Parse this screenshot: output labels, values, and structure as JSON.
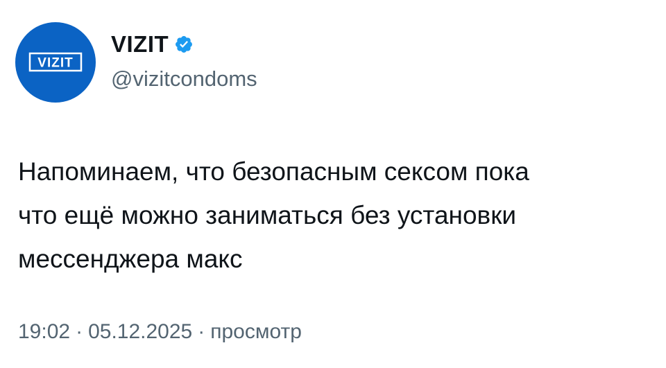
{
  "author": {
    "avatar_logo_text": "VIZIT",
    "avatar_bg_color": "#0b63c4",
    "display_name": "VIZIT",
    "verified": true,
    "verified_color": "#1d9bf0",
    "handle": "@vizitcondoms"
  },
  "tweet": {
    "text": "Напоминаем, что безопасным сексом пока\nчто ещё можно заниматься без установки\nмессенджера макс"
  },
  "meta": {
    "time": "19:02",
    "separator": "·",
    "date": "05.12.2025",
    "views_label": "просмотр"
  }
}
